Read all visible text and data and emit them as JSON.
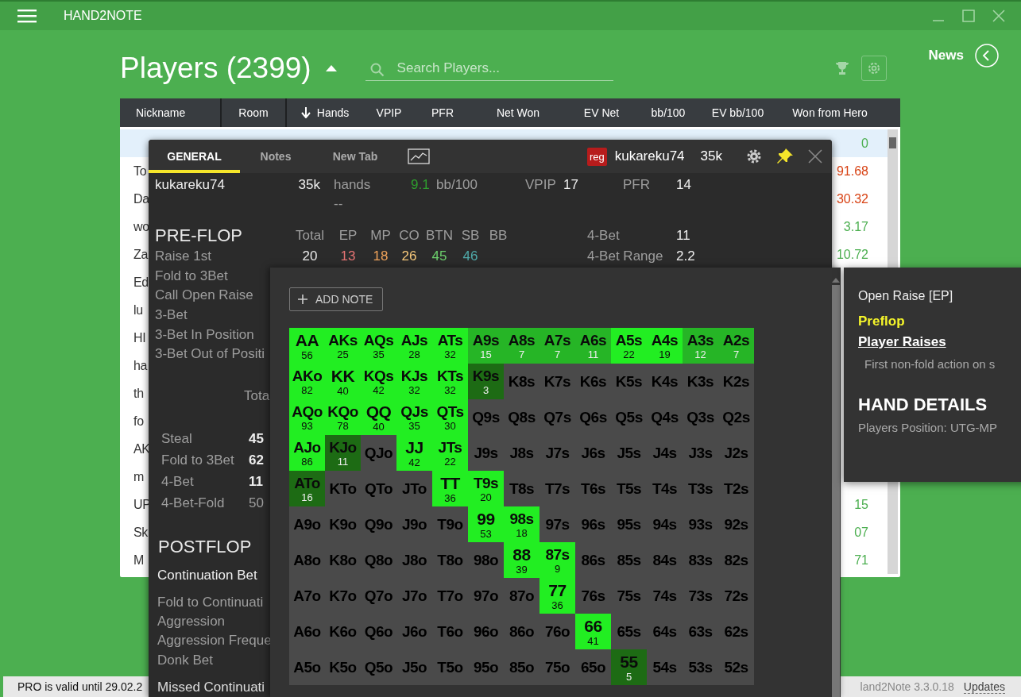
{
  "app": {
    "title": "HAND2NOTE"
  },
  "header": {
    "title": "Players (2399)",
    "search": {
      "placeholder": "Search Players..."
    },
    "news": "News"
  },
  "table": {
    "columns": [
      {
        "label": "Nickname",
        "sorted": false
      },
      {
        "label": "Room",
        "sorted": false
      },
      {
        "label": "Hands",
        "sorted": true
      },
      {
        "label": "VPIP",
        "sorted": false
      },
      {
        "label": "PFR",
        "sorted": false
      },
      {
        "label": "Net Won",
        "sorted": false
      },
      {
        "label": "EV Net",
        "sorted": false
      },
      {
        "label": "bb/100",
        "sorted": false
      },
      {
        "label": "EV bb/100",
        "sorted": false
      },
      {
        "label": "Won from Hero",
        "sorted": false
      }
    ],
    "rows": [
      {
        "won": "0",
        "color": "#4caf50",
        "selected": true
      },
      {
        "nickname": "To",
        "won": "91.68",
        "color": "#d84315",
        "selected": false
      },
      {
        "nickname": "Da",
        "won": "30.32",
        "color": "#d84315",
        "selected": false
      },
      {
        "nickname": "wo",
        "won": "3.17",
        "color": "#4caf50",
        "selected": false
      },
      {
        "nickname": "Za",
        "won": "10.72",
        "color": "#4caf50",
        "selected": false
      },
      {
        "nickname": "Ed",
        "selected": false
      },
      {
        "nickname": "lu",
        "selected": false
      },
      {
        "nickname": "HI",
        "selected": false
      },
      {
        "nickname": "ha",
        "selected": false
      },
      {
        "nickname": "th",
        "selected": false
      },
      {
        "nickname": "fo",
        "selected": false
      },
      {
        "nickname": "AK",
        "selected": false
      },
      {
        "nickname": "m",
        "selected": false
      },
      {
        "nickname": "UP",
        "won": "15",
        "color": "#4caf50",
        "selected": false
      },
      {
        "nickname": "Sk",
        "won": "07",
        "color": "#4caf50",
        "selected": false
      },
      {
        "nickname": "M",
        "won": "71",
        "color": "#4caf50",
        "selected": false
      }
    ]
  },
  "hud": {
    "tabs": [
      {
        "kind": "text",
        "label": "GENERAL",
        "selected": true
      },
      {
        "kind": "text",
        "label": "Notes",
        "selected": false
      },
      {
        "kind": "text",
        "label": "New Tab",
        "selected": false
      },
      {
        "kind": "chart",
        "selected": false
      }
    ],
    "badge": "reg",
    "player": "kukareku74",
    "hands": "35k",
    "summary": {
      "name": "kukareku74",
      "hands": "35k",
      "hands_label": "hands",
      "winrate": "9.1",
      "winrate_label": "bb/100",
      "vpip_label": "VPIP",
      "vpip": "17",
      "pfr_label": "PFR",
      "pfr": "14",
      "empty": "--"
    },
    "preflop": {
      "title": "PRE-FLOP",
      "columns": [
        "Total",
        "EP",
        "MP",
        "CO",
        "BTN",
        "SB",
        "BB"
      ],
      "side": [
        {
          "label": "4-Bet",
          "value": "11"
        },
        {
          "label": "4-Bet Range",
          "value": "2.2"
        }
      ],
      "rows": [
        {
          "label": "Raise 1st",
          "values": [
            {
              "text": "20",
              "color": "#e8e8e8"
            },
            {
              "text": "13",
              "color": "#e57373"
            },
            {
              "text": "18",
              "color": "#f0a35a"
            },
            {
              "text": "26",
              "color": "#f5c77a"
            },
            {
              "text": "45",
              "color": "#6ccf6c"
            },
            {
              "text": "46",
              "color": "#4fa9a9"
            }
          ]
        },
        {
          "label": "Fold to 3Bet",
          "values": []
        },
        {
          "label": "Call Open Raise",
          "values": []
        },
        {
          "label": "3-Bet",
          "values": []
        },
        {
          "label": "3-Bet In Position",
          "values": []
        },
        {
          "label": "3-Bet Out of Positi",
          "values": []
        }
      ]
    },
    "steal": {
      "column": "Tota",
      "rows": [
        {
          "label": "Steal",
          "value": "45",
          "muted": false
        },
        {
          "label": "Fold to 3Bet",
          "value": "62",
          "muted": false
        },
        {
          "label": "4-Bet",
          "value": "11",
          "muted": false
        },
        {
          "label": "4-Bet-Fold",
          "value": "50",
          "muted": true
        }
      ]
    },
    "postflop": {
      "title": "POSTFLOP",
      "subtitle": "Continuation Bet",
      "items": [
        "Fold to Continuati",
        "Aggression",
        "Aggression Freque",
        "Donk Bet"
      ],
      "next": "Missed Continuati"
    }
  },
  "range": {
    "add_note": "ADD NOTE",
    "grid": [
      [
        {
          "hand": "AA",
          "count": "56",
          "kind": "high"
        },
        {
          "hand": "AKs",
          "count": "25",
          "kind": "high"
        },
        {
          "hand": "AQs",
          "count": "35",
          "kind": "high"
        },
        {
          "hand": "AJs",
          "count": "28",
          "kind": "high"
        },
        {
          "hand": "ATs",
          "count": "32",
          "kind": "high"
        },
        {
          "hand": "A9s",
          "count": "15",
          "kind": "mid"
        },
        {
          "hand": "A8s",
          "count": "7",
          "kind": "mid"
        },
        {
          "hand": "A7s",
          "count": "7",
          "kind": "mid"
        },
        {
          "hand": "A6s",
          "count": "11",
          "kind": "mid"
        },
        {
          "hand": "A5s",
          "count": "22",
          "kind": "high"
        },
        {
          "hand": "A4s",
          "count": "19",
          "kind": "high"
        },
        {
          "hand": "A3s",
          "count": "12",
          "kind": "mid"
        },
        {
          "hand": "A2s",
          "count": "7",
          "kind": "mid"
        }
      ],
      [
        {
          "hand": "AKo",
          "count": "82",
          "kind": "high"
        },
        {
          "hand": "KK",
          "count": "40",
          "kind": "high"
        },
        {
          "hand": "KQs",
          "count": "42",
          "kind": "high"
        },
        {
          "hand": "KJs",
          "count": "32",
          "kind": "high"
        },
        {
          "hand": "KTs",
          "count": "32",
          "kind": "high"
        },
        {
          "hand": "K9s",
          "count": "3",
          "kind": "low"
        },
        {
          "hand": "K8s",
          "kind": "empty"
        },
        {
          "hand": "K7s",
          "kind": "empty"
        },
        {
          "hand": "K6s",
          "kind": "empty"
        },
        {
          "hand": "K5s",
          "kind": "empty"
        },
        {
          "hand": "K4s",
          "kind": "empty"
        },
        {
          "hand": "K3s",
          "kind": "empty"
        },
        {
          "hand": "K2s",
          "kind": "empty"
        }
      ],
      [
        {
          "hand": "AQo",
          "count": "93",
          "kind": "high"
        },
        {
          "hand": "KQo",
          "count": "78",
          "kind": "high"
        },
        {
          "hand": "QQ",
          "count": "40",
          "kind": "high"
        },
        {
          "hand": "QJs",
          "count": "35",
          "kind": "high"
        },
        {
          "hand": "QTs",
          "count": "30",
          "kind": "high"
        },
        {
          "hand": "Q9s",
          "kind": "empty"
        },
        {
          "hand": "Q8s",
          "kind": "empty"
        },
        {
          "hand": "Q7s",
          "kind": "empty"
        },
        {
          "hand": "Q6s",
          "kind": "empty"
        },
        {
          "hand": "Q5s",
          "kind": "empty"
        },
        {
          "hand": "Q4s",
          "kind": "empty"
        },
        {
          "hand": "Q3s",
          "kind": "empty"
        },
        {
          "hand": "Q2s",
          "kind": "empty"
        }
      ],
      [
        {
          "hand": "AJo",
          "count": "86",
          "kind": "high"
        },
        {
          "hand": "KJo",
          "count": "11",
          "kind": "low"
        },
        {
          "hand": "QJo",
          "kind": "empty"
        },
        {
          "hand": "JJ",
          "count": "42",
          "kind": "high"
        },
        {
          "hand": "JTs",
          "count": "22",
          "kind": "high"
        },
        {
          "hand": "J9s",
          "kind": "empty"
        },
        {
          "hand": "J8s",
          "kind": "empty"
        },
        {
          "hand": "J7s",
          "kind": "empty"
        },
        {
          "hand": "J6s",
          "kind": "empty"
        },
        {
          "hand": "J5s",
          "kind": "empty"
        },
        {
          "hand": "J4s",
          "kind": "empty"
        },
        {
          "hand": "J3s",
          "kind": "empty"
        },
        {
          "hand": "J2s",
          "kind": "empty"
        }
      ],
      [
        {
          "hand": "ATo",
          "count": "16",
          "kind": "low"
        },
        {
          "hand": "KTo",
          "kind": "empty"
        },
        {
          "hand": "QTo",
          "kind": "empty"
        },
        {
          "hand": "JTo",
          "kind": "empty"
        },
        {
          "hand": "TT",
          "count": "36",
          "kind": "high"
        },
        {
          "hand": "T9s",
          "count": "20",
          "kind": "high"
        },
        {
          "hand": "T8s",
          "kind": "empty"
        },
        {
          "hand": "T7s",
          "kind": "empty"
        },
        {
          "hand": "T6s",
          "kind": "empty"
        },
        {
          "hand": "T5s",
          "kind": "empty"
        },
        {
          "hand": "T4s",
          "kind": "empty"
        },
        {
          "hand": "T3s",
          "kind": "empty"
        },
        {
          "hand": "T2s",
          "kind": "empty"
        }
      ],
      [
        {
          "hand": "A9o",
          "kind": "empty"
        },
        {
          "hand": "K9o",
          "kind": "empty"
        },
        {
          "hand": "Q9o",
          "kind": "empty"
        },
        {
          "hand": "J9o",
          "kind": "empty"
        },
        {
          "hand": "T9o",
          "kind": "empty"
        },
        {
          "hand": "99",
          "count": "53",
          "kind": "high"
        },
        {
          "hand": "98s",
          "count": "18",
          "kind": "high"
        },
        {
          "hand": "97s",
          "kind": "empty"
        },
        {
          "hand": "96s",
          "kind": "empty"
        },
        {
          "hand": "95s",
          "kind": "empty"
        },
        {
          "hand": "94s",
          "kind": "empty"
        },
        {
          "hand": "93s",
          "kind": "empty"
        },
        {
          "hand": "92s",
          "kind": "empty"
        }
      ],
      [
        {
          "hand": "A8o",
          "kind": "empty"
        },
        {
          "hand": "K8o",
          "kind": "empty"
        },
        {
          "hand": "Q8o",
          "kind": "empty"
        },
        {
          "hand": "J8o",
          "kind": "empty"
        },
        {
          "hand": "T8o",
          "kind": "empty"
        },
        {
          "hand": "98o",
          "kind": "empty"
        },
        {
          "hand": "88",
          "count": "39",
          "kind": "high"
        },
        {
          "hand": "87s",
          "count": "9",
          "kind": "high"
        },
        {
          "hand": "86s",
          "kind": "empty"
        },
        {
          "hand": "85s",
          "kind": "empty"
        },
        {
          "hand": "84s",
          "kind": "empty"
        },
        {
          "hand": "83s",
          "kind": "empty"
        },
        {
          "hand": "82s",
          "kind": "empty"
        }
      ],
      [
        {
          "hand": "A7o",
          "kind": "empty"
        },
        {
          "hand": "K7o",
          "kind": "empty"
        },
        {
          "hand": "Q7o",
          "kind": "empty"
        },
        {
          "hand": "J7o",
          "kind": "empty"
        },
        {
          "hand": "T7o",
          "kind": "empty"
        },
        {
          "hand": "97o",
          "kind": "empty"
        },
        {
          "hand": "87o",
          "kind": "empty"
        },
        {
          "hand": "77",
          "count": "36",
          "kind": "high"
        },
        {
          "hand": "76s",
          "kind": "empty"
        },
        {
          "hand": "75s",
          "kind": "empty"
        },
        {
          "hand": "74s",
          "kind": "empty"
        },
        {
          "hand": "73s",
          "kind": "empty"
        },
        {
          "hand": "72s",
          "kind": "empty"
        }
      ],
      [
        {
          "hand": "A6o",
          "kind": "empty"
        },
        {
          "hand": "K6o",
          "kind": "empty"
        },
        {
          "hand": "Q6o",
          "kind": "empty"
        },
        {
          "hand": "J6o",
          "kind": "empty"
        },
        {
          "hand": "T6o",
          "kind": "empty"
        },
        {
          "hand": "96o",
          "kind": "empty"
        },
        {
          "hand": "86o",
          "kind": "empty"
        },
        {
          "hand": "76o",
          "kind": "empty"
        },
        {
          "hand": "66",
          "count": "41",
          "kind": "high"
        },
        {
          "hand": "65s",
          "kind": "empty"
        },
        {
          "hand": "64s",
          "kind": "empty"
        },
        {
          "hand": "63s",
          "kind": "empty"
        },
        {
          "hand": "62s",
          "kind": "empty"
        }
      ],
      [
        {
          "hand": "A5o",
          "kind": "empty"
        },
        {
          "hand": "K5o",
          "kind": "empty"
        },
        {
          "hand": "Q5o",
          "kind": "empty"
        },
        {
          "hand": "J5o",
          "kind": "empty"
        },
        {
          "hand": "T5o",
          "kind": "empty"
        },
        {
          "hand": "95o",
          "kind": "empty"
        },
        {
          "hand": "85o",
          "kind": "empty"
        },
        {
          "hand": "75o",
          "kind": "empty"
        },
        {
          "hand": "65o",
          "kind": "empty"
        },
        {
          "hand": "55",
          "count": "5",
          "kind": "low"
        },
        {
          "hand": "54s",
          "kind": "empty"
        },
        {
          "hand": "53s",
          "kind": "empty"
        },
        {
          "hand": "52s",
          "kind": "empty"
        }
      ]
    ]
  },
  "tooltip": {
    "title": "Open Raise [EP]",
    "street": "Preflop",
    "action": "Player Raises",
    "description": "First non-fold action on s",
    "section": "HAND DETAILS",
    "detail": "Players Position: UTG-MP"
  },
  "status_bar": {
    "license": "PRO is valid until 29.02.2",
    "version": "land2Note 3.3.0.18",
    "updates": "Updates"
  }
}
